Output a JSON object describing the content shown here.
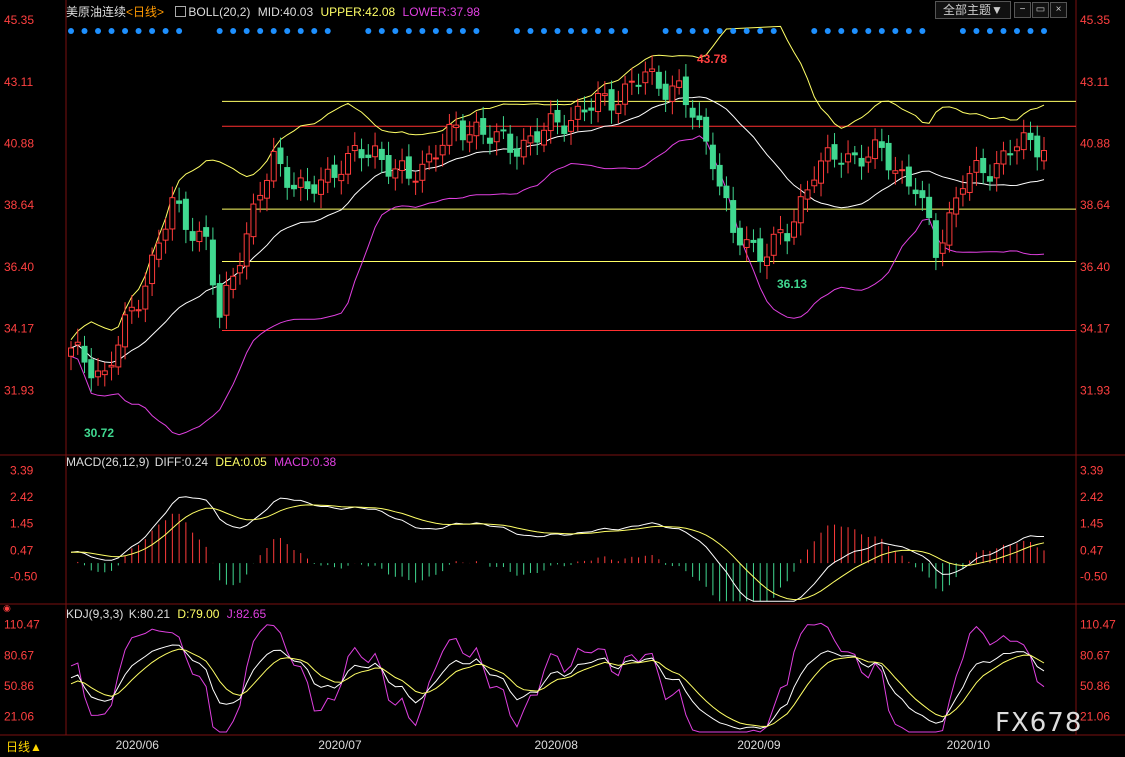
{
  "header": {
    "instrument": "美原油连续",
    "period": "<日线>",
    "boll_label": "BOLL(20,2)",
    "mid": "MID:40.03",
    "upper": "UPPER:42.08",
    "lower": "LOWER:37.98",
    "theme_button": "全部主题▼"
  },
  "macd_header": {
    "label": "MACD(26,12,9)",
    "diff": "DIFF:0.24",
    "dea": "DEA:0.05",
    "macd": "MACD:0.38"
  },
  "kdj_header": {
    "label": "KDJ(9,3,3)",
    "k": "K:80.21",
    "d": "D:79.00",
    "j": "J:82.65"
  },
  "period_tab": "日线▲",
  "watermark": "FX678",
  "colors": {
    "up": "#ff3b3b",
    "down": "#40d890",
    "axis_text": "#ff4040",
    "mid": "#ffffff",
    "upper": "#ffff66",
    "lower": "#e040e0",
    "diff": "#ffffff",
    "dea": "#ffff66",
    "j": "#e040e0",
    "dots": "#1e90ff"
  },
  "chart_data": [
    {
      "type": "candlestick",
      "title": "美原油连续 日线",
      "ylim": [
        29.7,
        45.35
      ],
      "y_ticks": [
        "45.35",
        "43.11",
        "40.88",
        "38.64",
        "36.40",
        "34.17",
        "31.93"
      ],
      "x_ticks": [
        "2020/06",
        "2020/07",
        "2020/08",
        "2020/09",
        "2020/10"
      ],
      "annotations": {
        "high": "43.78",
        "low": "36.13",
        "start_low": "30.72"
      },
      "series_names": {
        "mid": "MID",
        "upper": "UPPER",
        "lower": "LOWER"
      },
      "h_levels": [
        {
          "value": 42.4,
          "color": "#ffff66"
        },
        {
          "value": 41.5,
          "color": "#ff3030"
        },
        {
          "value": 38.5,
          "color": "#ffff66"
        },
        {
          "value": 36.6,
          "color": "#ffff66"
        },
        {
          "value": 34.1,
          "color": "#ff3030"
        }
      ],
      "keypoints": [
        [
          0,
          33.3
        ],
        [
          5,
          32.5
        ],
        [
          10,
          35.3
        ],
        [
          15,
          38.6
        ],
        [
          20,
          37.3
        ],
        [
          22,
          34.5
        ],
        [
          25,
          37.0
        ],
        [
          30,
          40.3
        ],
        [
          35,
          39.0
        ],
        [
          40,
          40.2
        ],
        [
          45,
          40.6
        ],
        [
          50,
          39.5
        ],
        [
          55,
          41.0
        ],
        [
          60,
          41.5
        ],
        [
          65,
          40.7
        ],
        [
          70,
          41.3
        ],
        [
          75,
          42.0
        ],
        [
          80,
          42.5
        ],
        [
          85,
          43.3
        ],
        [
          90,
          42.8
        ],
        [
          95,
          40.5
        ],
        [
          98,
          37.5
        ],
        [
          102,
          37.0
        ],
        [
          106,
          37.5
        ],
        [
          110,
          40.0
        ],
        [
          114,
          40.4
        ],
        [
          120,
          40.5
        ],
        [
          125,
          39.3
        ],
        [
          128,
          37.0
        ],
        [
          132,
          39.5
        ],
        [
          136,
          40.0
        ],
        [
          140,
          40.8
        ],
        [
          144,
          40.9
        ]
      ],
      "candle_count": 145,
      "date_ticks_index": [
        10,
        40,
        72,
        102,
        133
      ]
    },
    {
      "type": "bar+line",
      "title": "MACD(26,12,9)",
      "ylim": [
        -1.5,
        3.6
      ],
      "y_ticks": [
        "3.39",
        "2.42",
        "1.45",
        "0.47",
        "-0.50"
      ],
      "series": [
        {
          "name": "DIFF"
        },
        {
          "name": "DEA"
        },
        {
          "name": "MACD"
        }
      ]
    },
    {
      "type": "line",
      "title": "KDJ(9,3,3)",
      "ylim": [
        5,
        118
      ],
      "y_ticks": [
        "110.47",
        "80.67",
        "50.86",
        "21.06"
      ],
      "series": [
        {
          "name": "K"
        },
        {
          "name": "D"
        },
        {
          "name": "J"
        }
      ]
    }
  ]
}
